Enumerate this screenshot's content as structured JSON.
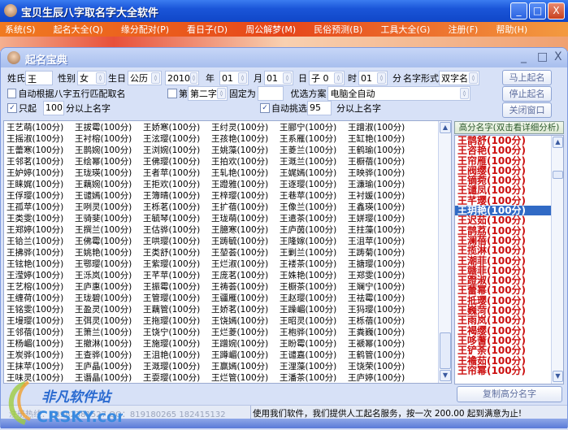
{
  "app": {
    "title": "宝贝生辰八字取名字大全软件",
    "minimize": "_",
    "maximize": "□",
    "close": "X"
  },
  "menu": [
    "系统(S)",
    "起名大全(Q)",
    "缘分配对(P)",
    "看日子(D)",
    "周公解梦(M)",
    "民俗预测(B)",
    "工具大全(G)",
    "注册(F)",
    "帮助(H)"
  ],
  "child": {
    "title": "起名宝典",
    "minimize": "_",
    "maximize": "□",
    "close": "X"
  },
  "form": {
    "surname_label": "姓氏",
    "surname": "王",
    "gender_label": "性别",
    "gender": "女",
    "birth_label": "生日",
    "calendar": "公历",
    "year": "2010",
    "year_label": "年",
    "month": "01",
    "month_label": "月",
    "day": "01",
    "day_label": "日",
    "hour": "子 0",
    "hour_label": "时",
    "minute": "01",
    "minute_label": "分",
    "form_label": "名字形式",
    "name_form": "双字名",
    "auto_wuxing_label": "自动根据八字五行匹配取名",
    "auto_wuxing_checked": false,
    "fixed_checked": false,
    "fixed_prefix": "第",
    "fixed_pos": "第二字",
    "fixed_label": "固定为",
    "fixed_value": "",
    "scheme_label": "优选方案",
    "scheme": "电脑全自动",
    "only_checked": true,
    "only_label": "只起",
    "only_score": "100",
    "only_suffix": "分以上名字",
    "auto_pick_checked": true,
    "auto_pick_label": "自动挑选",
    "auto_pick_score": "95",
    "auto_pick_suffix": "分以上名字"
  },
  "buttons": {
    "start": "马上起名",
    "stop": "停止起名",
    "close": "关闭窗口",
    "copy": "复制高分名字"
  },
  "score_suffix": "(100分)",
  "names": [
    [
      "王艺萌",
      "王摇淑",
      "王蕾寒",
      "王邻茗",
      "王妒婷",
      "王睐娓",
      "王俘璎",
      "王孤苹",
      "王类雯",
      "王郑婷",
      "王铪兰",
      "王拂骅",
      "王铉艳",
      "王滢婷",
      "王艺榕",
      "王缠荷",
      "王铭雯",
      "王墁璎",
      "王邻蓓",
      "王杨嵋",
      "王炭骅",
      "王抹苹",
      "王味灵"
    ],
    [
      "王拔霉",
      "王衬榕",
      "王鹊婉",
      "王绘幂",
      "王珑瑛",
      "王藕婉",
      "王谴嫣",
      "王咧灵",
      "王骑斐",
      "王撰兰",
      "王佛霉",
      "王姚艳",
      "王鄂璎",
      "王泺岚",
      "王庐惠",
      "王珑碧",
      "王盈灵",
      "王弭灵",
      "王箫兰",
      "王撤淋",
      "王查骅",
      "王庐晶",
      "王谮晶"
    ],
    [
      "王娇寒",
      "王泫璎",
      "王浏婉",
      "王佛璎",
      "王者苹",
      "王拒欢",
      "王簿晴",
      "王栎茗",
      "王毓琴",
      "王估骅",
      "王哄璎",
      "王类舒",
      "王紫璎",
      "王芊苹",
      "王振霉",
      "王管璎",
      "王藕管",
      "王拖璎",
      "王饶宁",
      "王施璎",
      "王沮艳",
      "王溉璎",
      "王耍璎"
    ],
    [
      "王纣灵",
      "王孩艳",
      "王姚藻",
      "王拍欢",
      "王轧艳",
      "王蹬雅",
      "王梓璎",
      "王扩蓓",
      "王珑萌",
      "王臆寒",
      "王踌毓",
      "王堃荟",
      "王烂淑",
      "王庞茗",
      "王祷荟",
      "王疆雁",
      "王娇茗",
      "王饶嫣",
      "王烂菱",
      "王蹭婉",
      "王蹲嵋",
      "王赢嫣",
      "王烂管"
    ],
    [
      "王郦宁",
      "王系雁",
      "王菱兰",
      "王溉兰",
      "王娓嫣",
      "王逐璎",
      "王巷苹",
      "王像兰",
      "王遣茶",
      "王庐茵",
      "王隆嫁",
      "王剿兰",
      "王褛茶",
      "王姝艳",
      "王橱茶",
      "王赵璎",
      "王躁嵋",
      "王昭灵",
      "王枹骅",
      "王盼霉",
      "王谴嘉",
      "王浬藻",
      "王潘茶"
    ],
    [
      "王蹭淑",
      "王缸艳",
      "王鹤瑜",
      "王橱蓓",
      "王映骅",
      "王濂瑜",
      "王衬媛",
      "王鑫瑛",
      "王姘璎",
      "王拄藻",
      "王沮苹",
      "王踌菊",
      "王搪璎",
      "王郑雯",
      "王斓宁",
      "王祛霉",
      "王犸璎",
      "王栎蓓",
      "王粪巍",
      "王褫幂",
      "王鹤管",
      "王饶荣",
      "王庐婷"
    ]
  ],
  "high": {
    "header": "高分名字(双击看详细分析)",
    "selected_index": 7,
    "items": [
      "王鹊舒",
      "王咨艳",
      "王帘雁",
      "王阀缨",
      "王镝菀",
      "王谴凤",
      "王芊璎",
      "王玥艳",
      "王迟茹",
      "王鹊荔",
      "王澜蓓",
      "王揽淋",
      "王潮菲",
      "王赣菲",
      "王蹬淑",
      "王蕾幂",
      "王抵璎",
      "王巍菏",
      "王雨岚",
      "王褐缨",
      "王哆蓍",
      "王铲荼",
      "王襜茹",
      "王帘幂"
    ]
  },
  "status": {
    "left": "注册热线：13982381527 QQ：819180265 182415132",
    "right": "使用我们软件，我们提供人工起名服务，按一次 200.00 起到满意为止!"
  },
  "watermark": {
    "cn": "非凡软件站",
    "en": "CRSKY.com"
  },
  "colors": {
    "title_blue": "#1a55d8",
    "menu_orange": "#e6461a",
    "high_name_red": "#cc1010",
    "selected": "#316ac5"
  }
}
